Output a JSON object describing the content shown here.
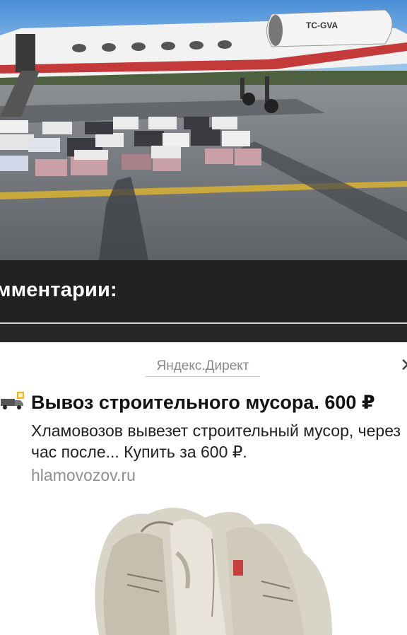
{
  "news_photo": {
    "aircraft_registration": "TC-GVA",
    "icon": "jet-with-cargo-photo"
  },
  "comments": {
    "title": "мментарии:"
  },
  "ad": {
    "source_label": "Яндекс.Директ",
    "close_icon": "close-icon",
    "favicon": "truck-icon",
    "title": "Вывоз строительного мусора. 600 ₽",
    "text": "Хламовозов вывезет строительный мусор, через час после... Купить за 600 ₽.",
    "domain": "hlamovozov.ru",
    "image_icon": "trash-bags-photo"
  },
  "colors": {
    "comments_bg": "#222222",
    "ad_source": "#8a8a8a",
    "ad_domain": "#8e8e8e"
  }
}
